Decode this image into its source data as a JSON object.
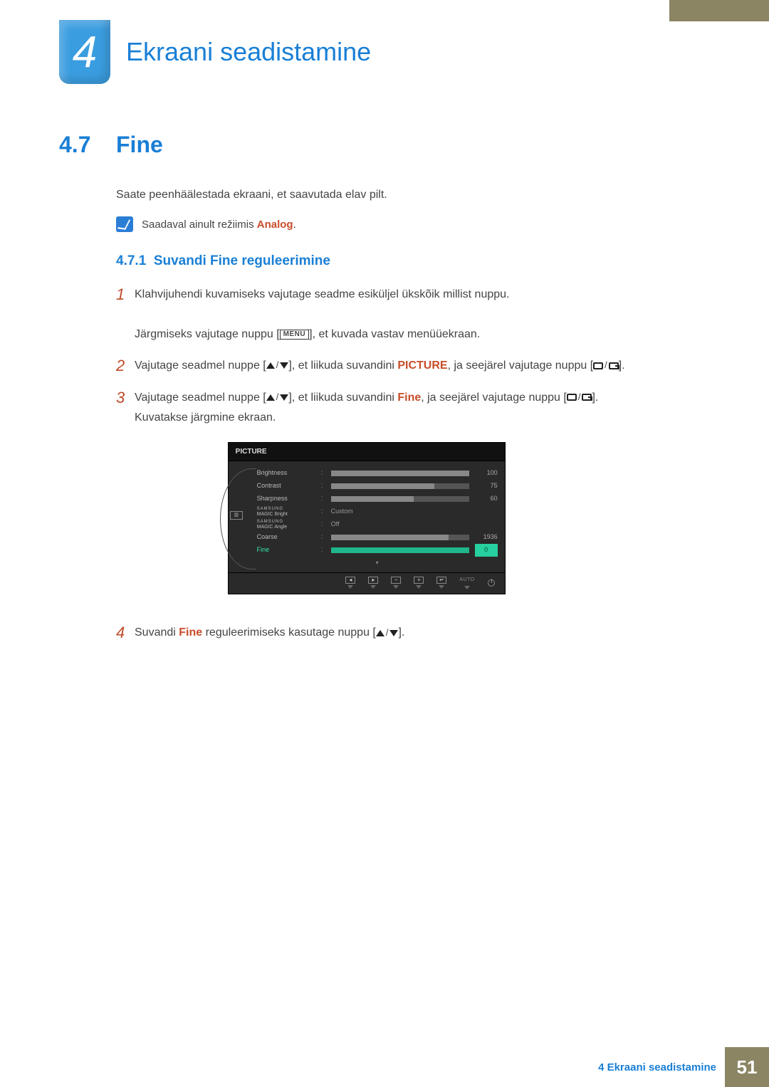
{
  "chapter": {
    "number": "4",
    "title": "Ekraani seadistamine"
  },
  "section": {
    "number": "4.7",
    "title": "Fine"
  },
  "intro": "Saate peenhäälestada ekraani, et saavutada elav pilt.",
  "note": {
    "prefix": "Saadaval ainult režiimis ",
    "hl": "Analog",
    "suffix": "."
  },
  "subsection": {
    "number": "4.7.1",
    "title": "Suvandi Fine reguleerimine"
  },
  "menu_label": "MENU",
  "steps": {
    "s1a": "Klahvijuhendi kuvamiseks vajutage seadme esiküljel ükskõik millist nuppu.",
    "s1b_pre": "Järgmiseks vajutage nuppu [",
    "s1b_post": "], et kuvada vastav menüüekraan.",
    "s2_pre": "Vajutage seadmel nuppe [",
    "s2_mid": "], et liikuda suvandini ",
    "s2_hl": "PICTURE",
    "s2_post": ", ja seejärel vajutage nuppu [",
    "s2_end": "].",
    "s3_pre": "Vajutage seadmel nuppe [",
    "s3_mid": "], et liikuda suvandini ",
    "s3_hl": "Fine",
    "s3_post": ", ja seejärel vajutage nuppu [",
    "s3_end": "].",
    "s3_tail": "Kuvatakse järgmine ekraan.",
    "s4_pre": "Suvandi ",
    "s4_hl": "Fine",
    "s4_mid": " reguleerimiseks kasutage nuppu [",
    "s4_end": "]."
  },
  "step_nums": {
    "n1": "1",
    "n2": "2",
    "n3": "3",
    "n4": "4"
  },
  "osd": {
    "title": "PICTURE",
    "side_icon": "▥",
    "magic_brand": "SAMSUNG",
    "magic_word": "MAGIC",
    "footer_auto": "AUTO",
    "down_caret": "▾",
    "rows": [
      {
        "label": "Brightness",
        "value": 100,
        "pct": 100
      },
      {
        "label": "Contrast",
        "value": 75,
        "pct": 75
      },
      {
        "label": "Sharpness",
        "value": 60,
        "pct": 60
      },
      {
        "label": "Bright",
        "text": "Custom",
        "magic": true
      },
      {
        "label": "Angle",
        "text": "Off",
        "magic": true
      },
      {
        "label": "Coarse",
        "value": 1936,
        "pct": 85
      },
      {
        "label": "Fine",
        "value": 0,
        "pct": 0,
        "selected": true
      }
    ]
  },
  "footer": {
    "text": "4 Ekraani seadistamine",
    "page": "51"
  }
}
